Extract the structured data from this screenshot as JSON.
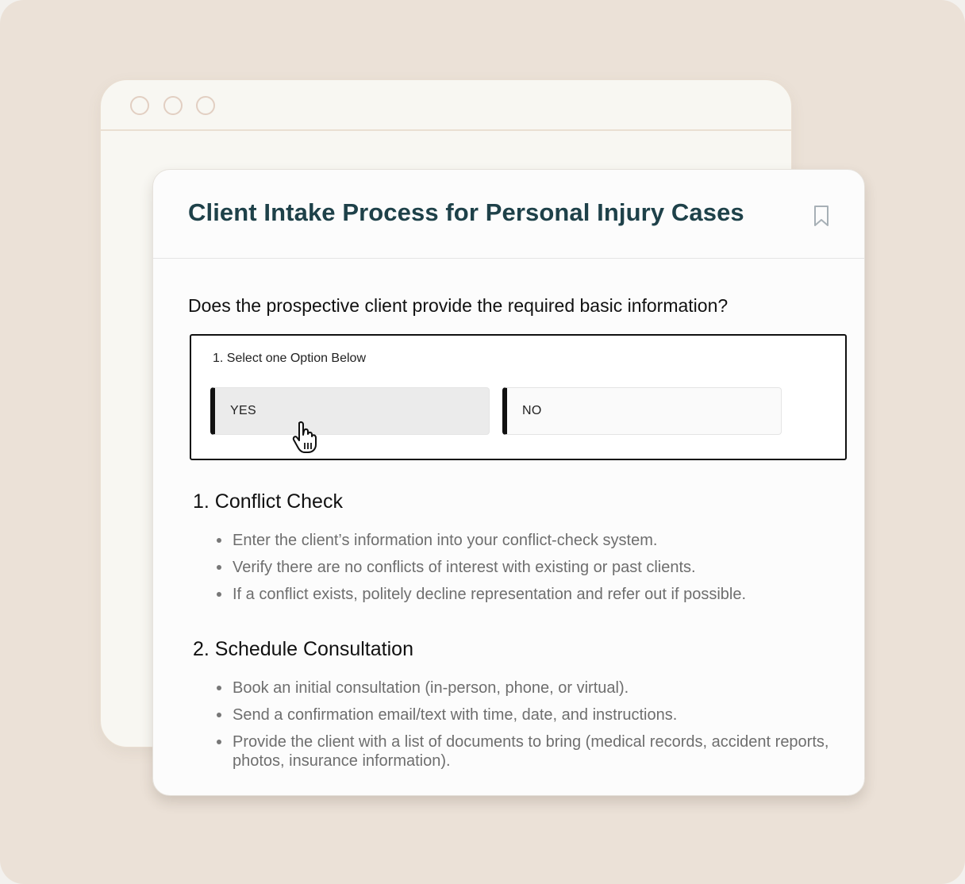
{
  "window": {
    "controls": [
      "circle",
      "circle",
      "circle"
    ]
  },
  "card": {
    "title": "Client Intake Process for Personal Injury Cases",
    "bookmark_icon": "bookmark-icon"
  },
  "question": {
    "text": "Does the prospective client provide the required basic information?",
    "instruction": "1. Select one Option Below",
    "options": [
      {
        "label": "YES",
        "state": "hovered"
      },
      {
        "label": "NO",
        "state": "default"
      }
    ],
    "cursor_icon": "hand-pointer-icon"
  },
  "sections": [
    {
      "title": "1. Conflict Check",
      "items": [
        "Enter the client’s information into your conflict-check system.",
        "Verify there are no conflicts of interest with existing or past clients.",
        "If a conflict exists, politely decline representation and refer out if possible."
      ]
    },
    {
      "title": "2. Schedule Consultation",
      "items": [
        "Book an initial consultation (in-person, phone, or virtual).",
        "Send a confirmation email/text with time, date, and instructions.",
        "Provide the client with a list of documents to bring (medical records, accident reports, photos, insurance information)."
      ]
    }
  ],
  "colors": {
    "background": "#ebe1d7",
    "title": "#1e4149",
    "bullet_text": "#6e6e6e",
    "hover_button": "#ebebeb"
  }
}
